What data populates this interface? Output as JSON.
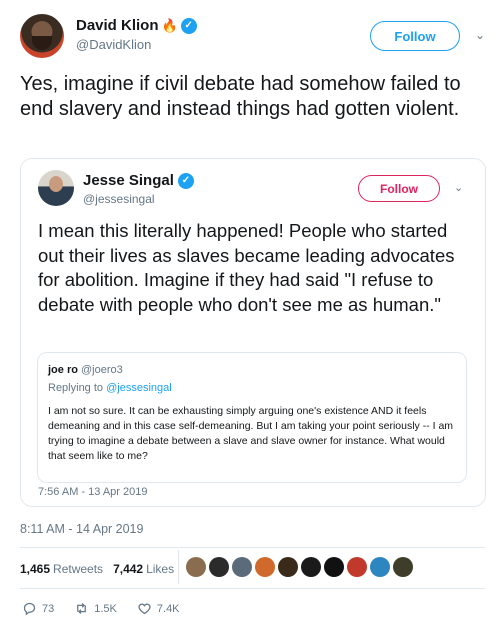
{
  "tweet": {
    "author_name": "David Klion",
    "author_handle": "@DavidKlion",
    "follow_label": "Follow",
    "text": "Yes, imagine if civil debate had somehow failed to end slavery and instead things had gotten violent.",
    "timestamp": "8:11 AM - 14 Apr 2019",
    "retweets_count": "1,465",
    "retweets_label": "Retweets",
    "likes_count": "7,442",
    "likes_label": "Likes",
    "actions": {
      "reply_count": "73",
      "retweet_count": "1.5K",
      "like_count": "7.4K"
    }
  },
  "quoted_tweet": {
    "author_name": "Jesse Singal",
    "author_handle": "@jessesingal",
    "follow_label": "Follow",
    "text": "I mean this literally happened! People who started out their lives as slaves became leading advocates for abolition. Imagine if they had said \"I refuse to debate with people who don't see me as human.\"",
    "timestamp": "7:56 AM - 13 Apr 2019",
    "nested": {
      "author_name": "joe ro",
      "author_handle": "@joero3",
      "replying_prefix": "Replying to",
      "replying_to": "@jessesingal",
      "text": "I am not so sure. It can be exhausting simply arguing one's existence AND it feels demeaning and in this case self-demeaning. But I am taking your point seriously -- I am trying to imagine a debate between a slave and slave owner for instance. What would that seem like to me?"
    }
  },
  "likers": [
    {
      "color": "#8a6d4e"
    },
    {
      "color": "#2b2b2b"
    },
    {
      "color": "#5c6b7a"
    },
    {
      "color": "#d06a2c"
    },
    {
      "color": "#3a2a1a"
    },
    {
      "color": "#1a1a1a"
    },
    {
      "color": "#111111"
    },
    {
      "color": "#c0392b"
    },
    {
      "color": "#2e86c1"
    },
    {
      "color": "#3d3d2a"
    }
  ],
  "colors": {
    "accent": "#1da1f2",
    "follow_pink": "#e0245e",
    "muted": "#657786"
  }
}
